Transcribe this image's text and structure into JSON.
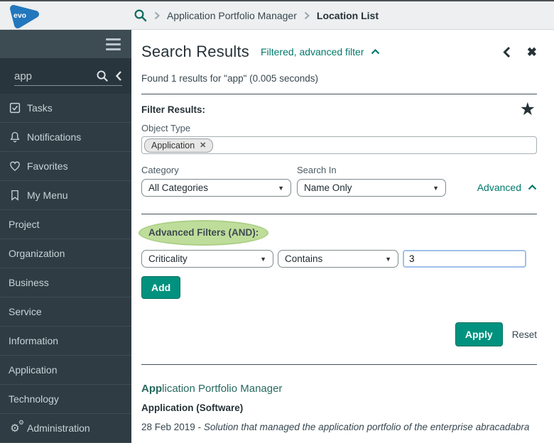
{
  "topbar": {
    "logo": "evo",
    "breadcrumb": {
      "items": [
        "Application Portfolio Manager",
        "Location List"
      ]
    }
  },
  "sidebar": {
    "search": {
      "value": "app"
    },
    "menu": [
      {
        "label": "Tasks"
      },
      {
        "label": "Notifications"
      },
      {
        "label": "Favorites"
      },
      {
        "label": "My Menu"
      },
      {
        "label": "Project"
      },
      {
        "label": "Organization"
      },
      {
        "label": "Business"
      },
      {
        "label": "Service"
      },
      {
        "label": "Information"
      },
      {
        "label": "Application"
      },
      {
        "label": "Technology"
      },
      {
        "label": "Administration"
      }
    ]
  },
  "main": {
    "title": "Search Results",
    "filter_state_link": "Filtered, advanced filter",
    "found_text": "Found 1 results for \"app\" (0.005 seconds)",
    "filter_results": {
      "heading": "Filter Results:",
      "object_type_label": "Object Type",
      "object_type_tags": [
        "Application"
      ],
      "category_label": "Category",
      "category_value": "All Categories",
      "search_in_label": "Search In",
      "search_in_value": "Name Only",
      "advanced_link": "Advanced"
    },
    "advanced_filters": {
      "heading": "Advanced Filters (AND):",
      "field_value": "Criticality",
      "operator_value": "Contains",
      "value_input": "3",
      "add_button": "Add",
      "apply_button": "Apply",
      "reset_link": "Reset"
    },
    "results": [
      {
        "title_match": "App",
        "title_rest": "lication Portfolio Manager",
        "type": "Application (Software)",
        "date": "28 Feb 2019",
        "separator": " - ",
        "description": "Solution that managed the application portfolio of the enterprise abracadabra"
      }
    ]
  },
  "icons": {
    "star": "★",
    "close": "✖",
    "select_arrow": "▼",
    "chip_remove": "✕",
    "gear": "⚙"
  },
  "colors": {
    "accent_teal": "#00796b",
    "button_teal": "#00927e",
    "result_title_teal": "#266a5e",
    "sidebar_bg": "#2f3c44",
    "sidebar_header_bg": "#3d4b53",
    "topbar_bg": "#edeff0",
    "highlight_green": "#b5d889",
    "logo_blue": "#2277bd"
  }
}
